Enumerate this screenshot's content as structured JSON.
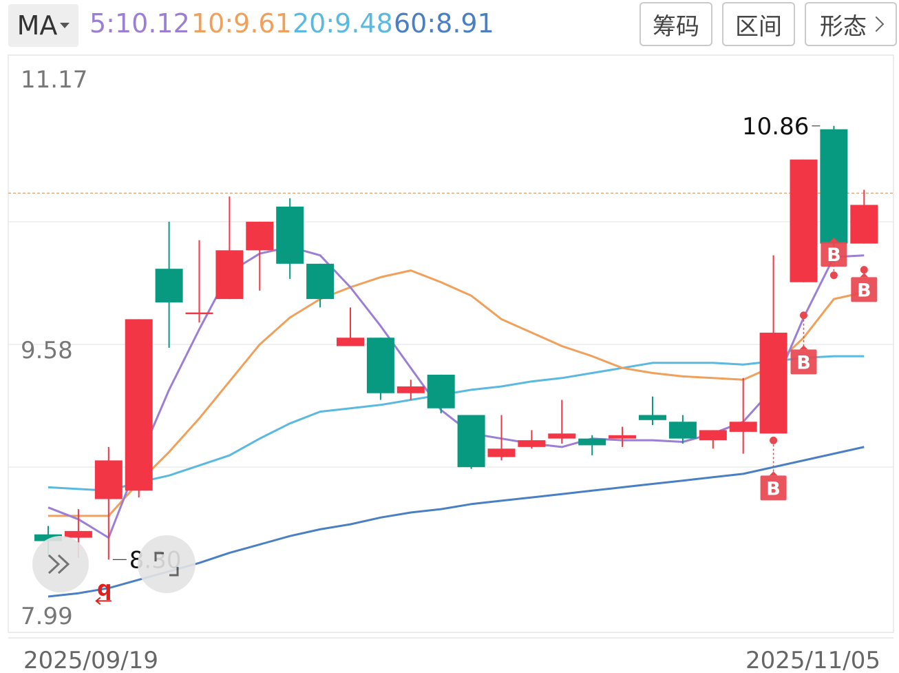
{
  "toolbar": {
    "indicator_label": "MA",
    "ma_values": [
      {
        "text": "5:10.12",
        "color": "#9b7fd4"
      },
      {
        "text": "10:9.61",
        "color": "#f0a05a"
      },
      {
        "text": "20:9.48",
        "color": "#5ab9e0"
      },
      {
        "text": "60:8.91",
        "color": "#4a7fc4"
      }
    ],
    "buttons": {
      "chips": "筹码",
      "range": "区间",
      "pattern": "形态"
    }
  },
  "colors": {
    "up": "#f23645",
    "down": "#089981",
    "ref_line": "#d9a070",
    "signal": "#e8474f"
  },
  "icons": {
    "collapse": "double-chevron-right-icon",
    "fullscreen": "fullscreen-icon"
  },
  "chart_data": {
    "type": "candlestick",
    "y_axis_labels": [
      "11.17",
      "9.58",
      "7.99"
    ],
    "ylim": [
      7.99,
      11.17
    ],
    "x_start_label": "2025/09/19",
    "x_end_label": "2025/11/05",
    "high_label": "10.86",
    "low_label": "8.30",
    "low_marker": "q",
    "candles": [
      {
        "o": 8.45,
        "h": 8.5,
        "l": 8.32,
        "c": 8.41
      },
      {
        "o": 8.43,
        "h": 8.6,
        "l": 8.31,
        "c": 8.47
      },
      {
        "o": 8.66,
        "h": 8.97,
        "l": 8.3,
        "c": 8.89
      },
      {
        "o": 8.71,
        "h": 9.73,
        "l": 8.67,
        "c": 9.73
      },
      {
        "o": 10.03,
        "h": 10.31,
        "l": 9.56,
        "c": 9.83
      },
      {
        "o": 9.77,
        "h": 10.2,
        "l": 9.71,
        "c": 9.77
      },
      {
        "o": 9.85,
        "h": 10.46,
        "l": 9.85,
        "c": 10.14
      },
      {
        "o": 10.14,
        "h": 10.31,
        "l": 9.9,
        "c": 10.31
      },
      {
        "o": 10.4,
        "h": 10.45,
        "l": 9.97,
        "c": 10.06
      },
      {
        "o": 10.06,
        "h": 10.06,
        "l": 9.8,
        "c": 9.85
      },
      {
        "o": 9.57,
        "h": 9.8,
        "l": 9.57,
        "c": 9.62
      },
      {
        "o": 9.62,
        "h": 9.62,
        "l": 9.25,
        "c": 9.29
      },
      {
        "o": 9.29,
        "h": 9.37,
        "l": 9.25,
        "c": 9.33
      },
      {
        "o": 9.4,
        "h": 9.4,
        "l": 9.17,
        "c": 9.2
      },
      {
        "o": 9.16,
        "h": 9.16,
        "l": 8.84,
        "c": 8.85
      },
      {
        "o": 8.91,
        "h": 9.16,
        "l": 8.89,
        "c": 8.96
      },
      {
        "o": 8.97,
        "h": 9.07,
        "l": 8.96,
        "c": 9.01
      },
      {
        "o": 9.02,
        "h": 9.25,
        "l": 8.99,
        "c": 9.05
      },
      {
        "o": 9.02,
        "h": 9.04,
        "l": 8.92,
        "c": 8.98
      },
      {
        "o": 9.02,
        "h": 9.09,
        "l": 8.97,
        "c": 9.04
      },
      {
        "o": 9.16,
        "h": 9.27,
        "l": 9.1,
        "c": 9.13
      },
      {
        "o": 9.12,
        "h": 9.16,
        "l": 8.99,
        "c": 9.02
      },
      {
        "o": 9.01,
        "h": 9.07,
        "l": 8.96,
        "c": 9.07
      },
      {
        "o": 9.06,
        "h": 9.38,
        "l": 8.93,
        "c": 9.12
      },
      {
        "o": 9.05,
        "h": 10.11,
        "l": 9.05,
        "c": 9.65
      },
      {
        "o": 9.95,
        "h": 10.68,
        "l": 9.95,
        "c": 10.68
      },
      {
        "o": 10.86,
        "h": 10.88,
        "l": 10.07,
        "c": 10.18
      },
      {
        "o": 10.18,
        "h": 10.5,
        "l": 10.18,
        "c": 10.41
      }
    ],
    "series": [
      {
        "name": "MA5",
        "color": "#9b7fd4",
        "width": 3,
        "values": [
          8.61,
          8.54,
          8.43,
          8.89,
          9.31,
          9.67,
          10.01,
          10.12,
          10.16,
          10.11,
          9.92,
          9.69,
          9.44,
          9.19,
          9.05,
          9.02,
          8.99,
          8.97,
          9.02,
          9.01,
          9.01,
          9.0,
          9.05,
          9.12,
          9.32,
          9.74,
          10.1,
          10.11
        ]
      },
      {
        "name": "MA10",
        "color": "#f0a05a",
        "width": 3,
        "values": [
          8.56,
          8.56,
          8.56,
          8.76,
          8.94,
          9.14,
          9.36,
          9.58,
          9.74,
          9.85,
          9.92,
          9.98,
          10.02,
          9.95,
          9.87,
          9.73,
          9.65,
          9.57,
          9.51,
          9.44,
          9.41,
          9.39,
          9.38,
          9.37,
          9.45,
          9.62,
          9.85,
          9.89
        ]
      },
      {
        "name": "MA20",
        "color": "#5ab9e0",
        "width": 3,
        "values": [
          8.73,
          8.72,
          8.71,
          8.76,
          8.8,
          8.86,
          8.92,
          9.02,
          9.11,
          9.18,
          9.2,
          9.22,
          9.25,
          9.28,
          9.31,
          9.33,
          9.36,
          9.38,
          9.41,
          9.44,
          9.47,
          9.47,
          9.47,
          9.46,
          9.48,
          9.5,
          9.51,
          9.51
        ]
      },
      {
        "name": "MA60",
        "color": "#4a7fc4",
        "width": 3,
        "values": [
          8.08,
          8.1,
          8.13,
          8.18,
          8.23,
          8.28,
          8.34,
          8.39,
          8.44,
          8.48,
          8.51,
          8.55,
          8.58,
          8.6,
          8.63,
          8.65,
          8.67,
          8.69,
          8.71,
          8.73,
          8.75,
          8.77,
          8.79,
          8.81,
          8.85,
          8.89,
          8.93,
          8.97
        ]
      }
    ],
    "signals": [
      {
        "i": 24,
        "price": 8.8,
        "label": "B"
      },
      {
        "i": 25,
        "price": 9.55,
        "label": "B"
      },
      {
        "i": 26,
        "price": 10.19,
        "label": "B"
      },
      {
        "i": 27,
        "price": 9.98,
        "label": "B"
      }
    ],
    "ref_price": 10.48
  }
}
